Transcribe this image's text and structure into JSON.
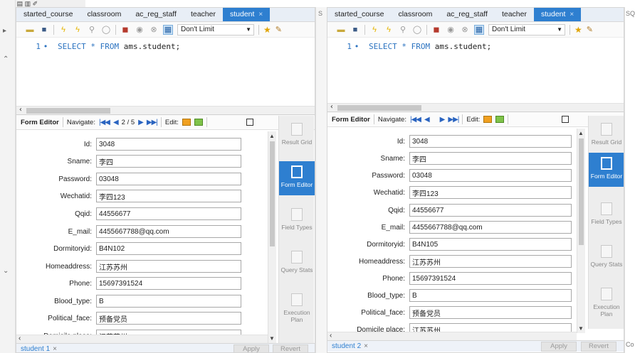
{
  "tabs": [
    "started_course",
    "classroom",
    "ac_reg_staff",
    "teacher",
    "student"
  ],
  "active_tab_close": "×",
  "toolbar": {
    "limit_label": "Don't Limit"
  },
  "editor": {
    "line_number": "1",
    "bullet": "•",
    "kw_select": "SELECT",
    "kw_star": "*",
    "kw_from": "FROM",
    "table_ref": "ams.student;"
  },
  "form_toolbar": {
    "title": "Form Editor",
    "navigate": "Navigate:",
    "edit": "Edit:"
  },
  "panel1": {
    "record_position": "2 / 5"
  },
  "side_buttons": {
    "result_grid": "Result Grid",
    "form_editor": "Form Editor",
    "field_types": "Field Types",
    "query_stats": "Query Stats",
    "execution_plan": "Execution Plan"
  },
  "labels": [
    "Id:",
    "Sname:",
    "Password:",
    "Wechatid:",
    "Qqid:",
    "E_mail:",
    "Dormitoryid:",
    "Homeaddress:",
    "Phone:",
    "Blood_type:",
    "Political_face:",
    "Domicile place:"
  ],
  "record1": [
    "3048",
    "李四",
    "03048",
    "李四123",
    "44556677",
    "4455667788@qq.com",
    "B4N102",
    "江苏苏州",
    "15697391524",
    "B",
    "预备党员",
    "江苏苏州"
  ],
  "record2": [
    "3048",
    "李四",
    "03048",
    "李四123",
    "44556677",
    "4455667788@qq.com",
    "B4N105",
    "江苏苏州",
    "15697391524",
    "B",
    "预备党员",
    "江苏苏州"
  ],
  "bottom": {
    "result_tab1": "student 1",
    "result_tab2": "student 2",
    "close": "×",
    "apply": "Apply",
    "revert": "Revert"
  },
  "edge_text": {
    "gap_label": "S",
    "right_label": "SQ",
    "right_bottom": "Co"
  }
}
